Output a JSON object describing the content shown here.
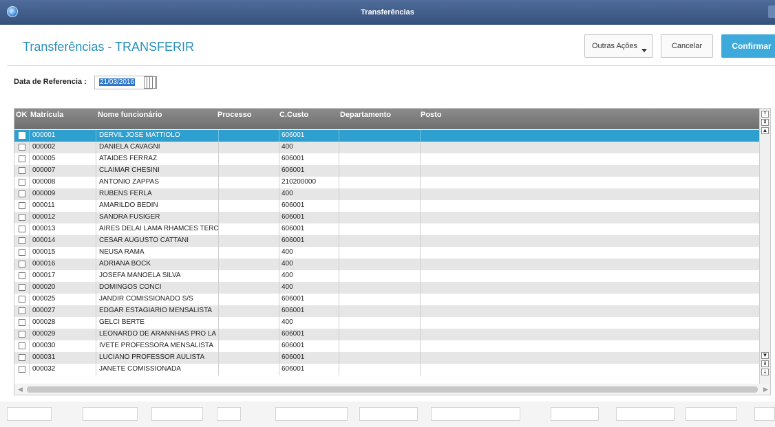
{
  "window": {
    "title": "Transferências"
  },
  "header": {
    "page_title": "Transferências - TRANSFERIR"
  },
  "actions": {
    "outras": "Outras Ações",
    "cancelar": "Cancelar",
    "confirmar": "Confirmar"
  },
  "filter": {
    "label": "Data de Referencia :",
    "value": "21/03/2016"
  },
  "table": {
    "columns": [
      "OK",
      "Matrícula",
      "Nome funcionário",
      "Processo",
      "C.Custo",
      "Departamento",
      "Posto"
    ],
    "rows": [
      {
        "mat": "000001",
        "nome": "DERVIL JOSE MATTIOLO",
        "ccusto": "606001"
      },
      {
        "mat": "000002",
        "nome": "DANIELA CAVAGNI",
        "ccusto": "400"
      },
      {
        "mat": "000005",
        "nome": "ATAIDES FERRAZ",
        "ccusto": "606001"
      },
      {
        "mat": "000007",
        "nome": "CLAIMAR CHESINI",
        "ccusto": "606001"
      },
      {
        "mat": "000008",
        "nome": "ANTONIO ZAPPAS",
        "ccusto": "210200000"
      },
      {
        "mat": "000009",
        "nome": "RUBENS FERLA",
        "ccusto": "400"
      },
      {
        "mat": "000011",
        "nome": "AMARILDO BEDIN",
        "ccusto": "606001"
      },
      {
        "mat": "000012",
        "nome": "SANDRA FUSIGER",
        "ccusto": "606001"
      },
      {
        "mat": "000013",
        "nome": "AIRES DELAI LAMA RHAMCES TERC",
        "ccusto": "606001"
      },
      {
        "mat": "000014",
        "nome": "CESAR AUGUSTO CATTANI",
        "ccusto": "606001"
      },
      {
        "mat": "000015",
        "nome": "NEUSA RAMA",
        "ccusto": "400"
      },
      {
        "mat": "000016",
        "nome": "ADRIANA BOCK",
        "ccusto": "400"
      },
      {
        "mat": "000017",
        "nome": "JOSEFA MANOELA SILVA",
        "ccusto": "400"
      },
      {
        "mat": "000020",
        "nome": "DOMINGOS CONCI",
        "ccusto": "400"
      },
      {
        "mat": "000025",
        "nome": "JANDIR COMISSIONADO S/S",
        "ccusto": "606001"
      },
      {
        "mat": "000027",
        "nome": "EDGAR ESTAGIARIO MENSALISTA",
        "ccusto": "606001"
      },
      {
        "mat": "000028",
        "nome": "GELCI BERTE",
        "ccusto": "400"
      },
      {
        "mat": "000029",
        "nome": "LEONARDO DE ARANNHAS PRO LA",
        "ccusto": "606001"
      },
      {
        "mat": "000030",
        "nome": "IVETE PROFESSORA MENSALISTA",
        "ccusto": "606001"
      },
      {
        "mat": "000031",
        "nome": "LUCIANO PROFESSOR AULISTA",
        "ccusto": "606001"
      },
      {
        "mat": "000032",
        "nome": "JANETE COMISSIONADA",
        "ccusto": "606001"
      }
    ]
  },
  "colors": {
    "accent": "#3eaadb",
    "selected_row": "#2ea0cf",
    "title_text": "#2a8fba"
  }
}
